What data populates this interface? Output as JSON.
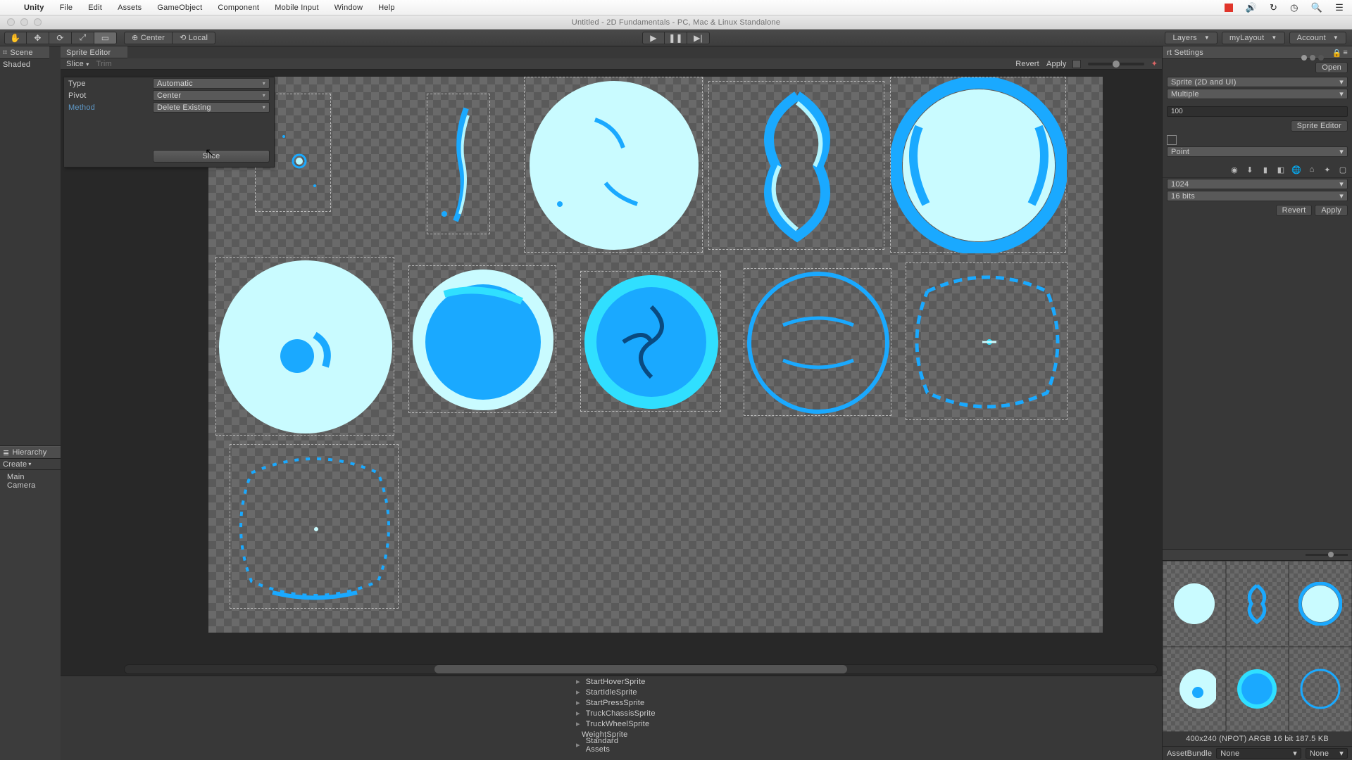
{
  "menubar": {
    "app": "Unity",
    "items": [
      "File",
      "Edit",
      "Assets",
      "GameObject",
      "Component",
      "Mobile Input",
      "Window",
      "Help"
    ]
  },
  "window_title": "Untitled - 2D Fundamentals - PC, Mac & Linux Standalone",
  "toolbar": {
    "pivot": {
      "center": "Center",
      "local": "Local"
    },
    "dropdowns": {
      "layers": "Layers",
      "layout": "myLayout",
      "account": "Account"
    }
  },
  "scene": {
    "tab": "Scene",
    "shade": "Shaded"
  },
  "hierarchy": {
    "tab": "Hierarchy",
    "create": "Create",
    "items": [
      "Main Camera"
    ]
  },
  "sprite_editor": {
    "tab": "Sprite Editor",
    "bar": {
      "slice": "Slice",
      "trim": "Trim",
      "revert": "Revert",
      "apply": "Apply"
    },
    "slice_popup": {
      "type_label": "Type",
      "type_value": "Automatic",
      "pivot_label": "Pivot",
      "pivot_value": "Center",
      "method_label": "Method",
      "method_value": "Delete Existing",
      "slice_btn": "Slice"
    }
  },
  "inspector": {
    "tab": "rt Settings",
    "open_btn": "Open",
    "sprite_type": "Sprite (2D and UI)",
    "sprite_mode": "Multiple",
    "ppu": "100",
    "sprite_editor_btn": "Sprite Editor",
    "filter": "Point",
    "max_size": "1024",
    "format": "16 bits",
    "revert": "Revert",
    "apply": "Apply",
    "meta": "400x240 (NPOT)  ARGB 16 bit  187.5 KB",
    "assetbundle": "AssetBundle",
    "ab_none": "None"
  },
  "project_tree": [
    {
      "icon": "orange",
      "name": "StartHoverSprite"
    },
    {
      "icon": "orange",
      "name": "StartIdleSprite"
    },
    {
      "icon": "orange",
      "name": "StartPressSprite"
    },
    {
      "icon": "img",
      "name": "TruckChassisSprite"
    },
    {
      "icon": "img",
      "name": "TruckWheelSprite"
    },
    {
      "icon": "img",
      "name": "WeightSprite"
    },
    {
      "icon": "folder",
      "name": "Standard Assets"
    }
  ]
}
